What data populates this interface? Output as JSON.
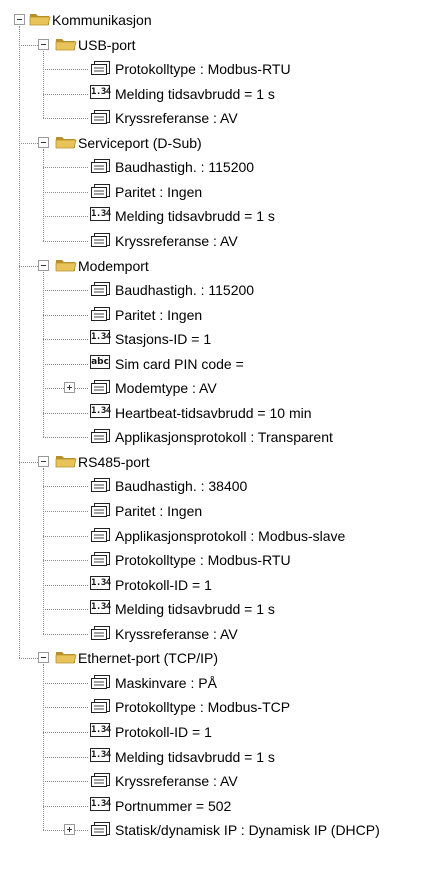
{
  "tree": {
    "label": "Kommunikasjon",
    "expanded": true,
    "icon": "folder-icon",
    "children": [
      {
        "label": "USB-port",
        "icon": "folder-icon",
        "expanded": true,
        "children": [
          {
            "label": "Protokolltype : Modbus-RTU",
            "icon": "list-icon"
          },
          {
            "label": "Melding tidsavbrudd = 1 s",
            "icon": "numeric-icon"
          },
          {
            "label": "Kryssreferanse : AV",
            "icon": "list-icon"
          }
        ]
      },
      {
        "label": "Serviceport (D-Sub)",
        "icon": "folder-icon",
        "expanded": true,
        "children": [
          {
            "label": "Baudhastigh. : 115200",
            "icon": "list-icon"
          },
          {
            "label": "Paritet : Ingen",
            "icon": "list-icon"
          },
          {
            "label": "Melding tidsavbrudd = 1 s",
            "icon": "numeric-icon"
          },
          {
            "label": "Kryssreferanse : AV",
            "icon": "list-icon"
          }
        ]
      },
      {
        "label": "Modemport",
        "icon": "folder-icon",
        "expanded": true,
        "children": [
          {
            "label": "Baudhastigh. : 115200",
            "icon": "list-icon"
          },
          {
            "label": "Paritet : Ingen",
            "icon": "list-icon"
          },
          {
            "label": "Stasjons-ID = 1",
            "icon": "numeric-icon"
          },
          {
            "label": "Sim card PIN code =",
            "icon": "text-icon"
          },
          {
            "label": "Modemtype : AV",
            "icon": "list-icon",
            "collapsed": true
          },
          {
            "label": "Heartbeat-tidsavbrudd = 10 min",
            "icon": "numeric-icon"
          },
          {
            "label": "Applikasjonsprotokoll : Transparent",
            "icon": "list-icon"
          }
        ]
      },
      {
        "label": "RS485-port",
        "icon": "folder-icon",
        "expanded": true,
        "children": [
          {
            "label": "Baudhastigh. : 38400",
            "icon": "list-icon"
          },
          {
            "label": "Paritet : Ingen",
            "icon": "list-icon"
          },
          {
            "label": "Applikasjonsprotokoll : Modbus-slave",
            "icon": "list-icon"
          },
          {
            "label": "Protokolltype : Modbus-RTU",
            "icon": "list-icon"
          },
          {
            "label": "Protokoll-ID = 1",
            "icon": "numeric-icon"
          },
          {
            "label": "Melding tidsavbrudd = 1 s",
            "icon": "numeric-icon"
          },
          {
            "label": "Kryssreferanse : AV",
            "icon": "list-icon"
          }
        ]
      },
      {
        "label": "Ethernet-port (TCP/IP)",
        "icon": "folder-icon",
        "expanded": true,
        "children": [
          {
            "label": "Maskinvare : PÅ",
            "icon": "list-icon"
          },
          {
            "label": "Protokolltype : Modbus-TCP",
            "icon": "list-icon"
          },
          {
            "label": "Protokoll-ID = 1",
            "icon": "numeric-icon"
          },
          {
            "label": "Melding tidsavbrudd = 1 s",
            "icon": "numeric-icon"
          },
          {
            "label": "Kryssreferanse : AV",
            "icon": "list-icon"
          },
          {
            "label": "Portnummer = 502",
            "icon": "numeric-icon"
          },
          {
            "label": "Statisk/dynamisk IP : Dynamisk IP (DHCP)",
            "icon": "list-icon",
            "collapsed": true
          }
        ]
      }
    ]
  },
  "icons": {
    "numeric_text": "1.34",
    "text_text": "abc"
  },
  "colors": {
    "folder": "#e8c35a",
    "folder_dark": "#b8902a",
    "tree_line": "#8a8a8a"
  }
}
